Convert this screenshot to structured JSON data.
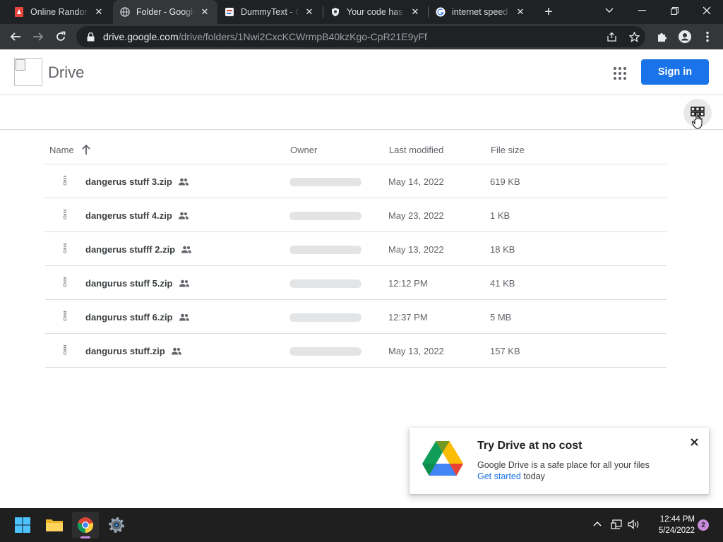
{
  "browser": {
    "tabs": [
      {
        "title": "Online Random",
        "favicon": "pdf-red-icon",
        "active": false
      },
      {
        "title": "Folder - Google",
        "favicon": "globe-icon",
        "active": true
      },
      {
        "title": "DummyText - C",
        "favicon": "dummytext-icon",
        "active": false
      },
      {
        "title": "Your code has b",
        "favicon": "shield-icon",
        "active": false
      },
      {
        "title": "internet speed t",
        "favicon": "google-g-icon",
        "active": false
      }
    ],
    "url_host": "drive.google.com",
    "url_path": "/drive/folders/1Nwi2CxcKCWrmpB40kzKgo-CpR21E9yFf"
  },
  "drive": {
    "title": "Drive",
    "sign_in_label": "Sign in",
    "columns": {
      "name": "Name",
      "owner": "Owner",
      "modified": "Last modified",
      "size": "File size"
    },
    "files": [
      {
        "name": "dangerus stuff 3.zip",
        "modified": "May 14, 2022",
        "size": "619 KB"
      },
      {
        "name": "dangerus stuff 4.zip",
        "modified": "May 23, 2022",
        "size": "1 KB"
      },
      {
        "name": "dangerus stufff 2.zip",
        "modified": "May 13, 2022",
        "size": "18 KB"
      },
      {
        "name": "dangurus stuff 5.zip",
        "modified": "12:12 PM",
        "size": "41 KB"
      },
      {
        "name": "dangurus stuff 6.zip",
        "modified": "12:37 PM",
        "size": "5 MB"
      },
      {
        "name": "dangurus stuff.zip",
        "modified": "May 13, 2022",
        "size": "157 KB"
      }
    ],
    "promo": {
      "title": "Try Drive at no cost",
      "body": "Google Drive is a safe place for all your files",
      "link": "Get started",
      "suffix": " today"
    }
  },
  "taskbar": {
    "time": "12:44 PM",
    "date": "5/24/2022",
    "notification_count": "2"
  },
  "colors": {
    "accent": "#1a73e8",
    "tab_strip": "#202124",
    "toolbar": "#35363a",
    "taskbar": "#1f1f1f"
  }
}
